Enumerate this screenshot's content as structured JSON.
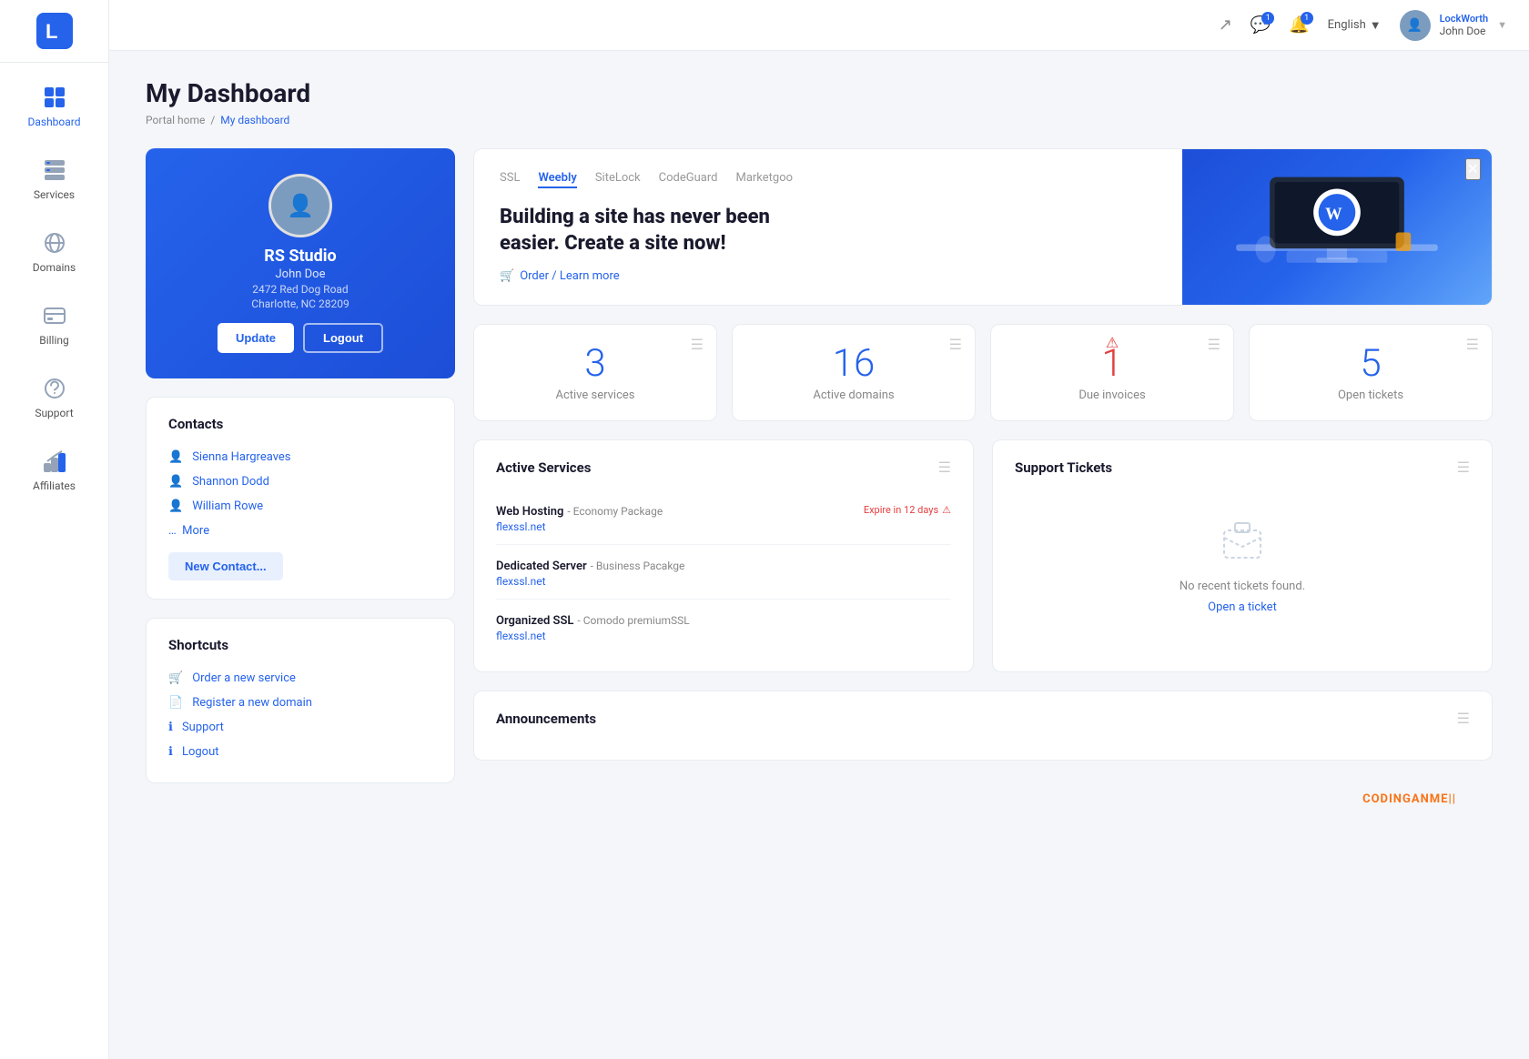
{
  "sidebar": {
    "logo_letter": "L",
    "items": [
      {
        "id": "dashboard",
        "label": "Dashboard",
        "icon": "dashboard"
      },
      {
        "id": "services",
        "label": "Services",
        "icon": "services"
      },
      {
        "id": "domains",
        "label": "Domains",
        "icon": "domains"
      },
      {
        "id": "billing",
        "label": "Billing",
        "icon": "billing"
      },
      {
        "id": "support",
        "label": "Support",
        "icon": "support"
      },
      {
        "id": "affiliates",
        "label": "Affiliates",
        "icon": "affiliates"
      }
    ]
  },
  "topbar": {
    "language": "English",
    "company": "LockWorth",
    "username": "John Doe"
  },
  "page": {
    "title": "My Dashboard",
    "breadcrumb_home": "Portal home",
    "breadcrumb_current": "My dashboard"
  },
  "profile": {
    "company": "RS Studio",
    "name": "John Doe",
    "address1": "2472 Red Dog Road",
    "address2": "Charlotte, NC 28209",
    "update_label": "Update",
    "logout_label": "Logout"
  },
  "contacts": {
    "title": "Contacts",
    "items": [
      {
        "name": "Sienna Hargreaves"
      },
      {
        "name": "Shannon Dodd"
      },
      {
        "name": "William Rowe"
      }
    ],
    "more_label": "More",
    "new_contact_label": "New Contact..."
  },
  "shortcuts": {
    "title": "Shortcuts",
    "items": [
      {
        "label": "Order a new service"
      },
      {
        "label": "Register a new domain"
      },
      {
        "label": "Support"
      },
      {
        "label": "Logout"
      }
    ]
  },
  "promo": {
    "tabs": [
      "SSL",
      "Weebly",
      "SiteLock",
      "CodeGuard",
      "Marketgoo"
    ],
    "active_tab": "Weebly",
    "title": "Building a site has never been easier. Create a site now!",
    "link_label": "Order / Learn more"
  },
  "stats": [
    {
      "number": "3",
      "label": "Active services",
      "color": "blue",
      "alert": false
    },
    {
      "number": "16",
      "label": "Active domains",
      "color": "blue",
      "alert": false
    },
    {
      "number": "1",
      "label": "Due invoices",
      "color": "red",
      "alert": true
    },
    {
      "number": "5",
      "label": "Open tickets",
      "color": "blue",
      "alert": false
    }
  ],
  "active_services": {
    "title": "Active Services",
    "items": [
      {
        "name": "Web Hosting",
        "package": "Economy Package",
        "link": "flexssl.net",
        "expire_label": "Expire in 12 days",
        "has_alert": true
      },
      {
        "name": "Dedicated Server",
        "package": "Business Pacakge",
        "link": "flexssl.net",
        "expire_label": "",
        "has_alert": false
      },
      {
        "name": "Organized SSL",
        "package": "Comodo premiumSSL",
        "link": "flexssl.net",
        "expire_label": "",
        "has_alert": false
      }
    ]
  },
  "support_tickets": {
    "title": "Support Tickets",
    "empty_text": "No recent tickets found.",
    "open_ticket_label": "Open a ticket"
  },
  "announcements": {
    "title": "Announcements"
  },
  "footer": {
    "brand_prefix": "CODINGANME",
    "brand_suffix": "||"
  }
}
